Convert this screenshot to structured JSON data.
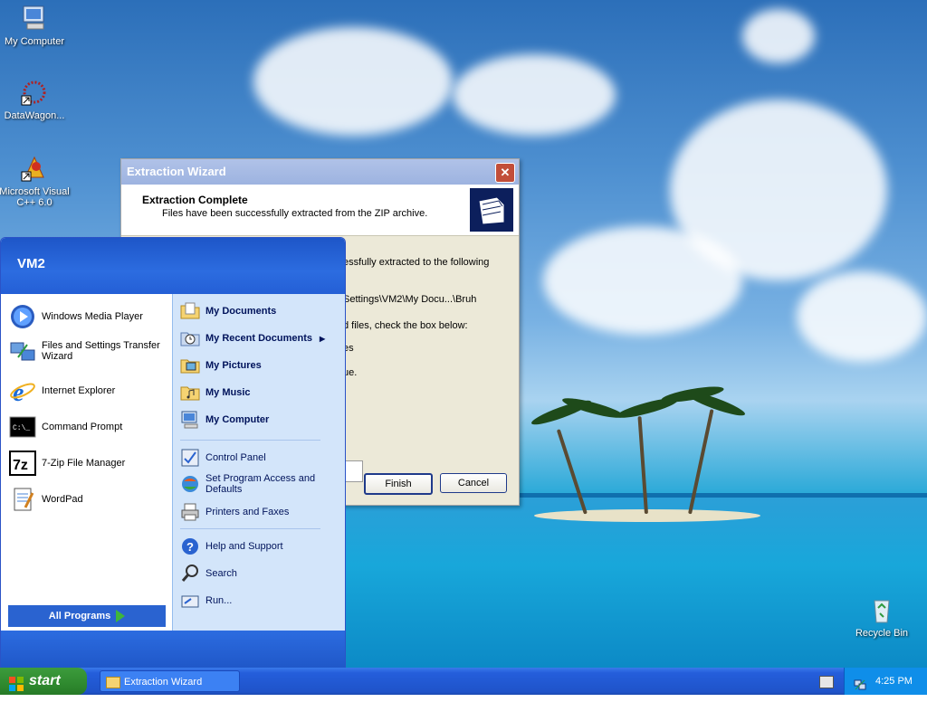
{
  "desktop": {
    "icons": [
      {
        "label": "My Computer"
      },
      {
        "label": "DataWagon..."
      },
      {
        "label": "Microsoft Visual C++ 6.0"
      },
      {
        "label": "Recycle Bin"
      }
    ]
  },
  "wizard": {
    "title": "Extraction Wizard",
    "close_label": "✕",
    "header_title": "Extraction Complete",
    "header_subtitle": "Files have been successfully extracted from the ZIP archive.",
    "body_lines": [
      "essfully extracted to the following",
      "Settings\\VM2\\My Docu...\\Bruh",
      "d files, check the box below:",
      "es",
      "ue."
    ],
    "finish_label": "Finish",
    "cancel_label": "Cancel"
  },
  "startmenu": {
    "user": "VM2",
    "pinned": [
      {
        "label": "Windows Media Player"
      },
      {
        "label": "Files and Settings Transfer Wizard"
      },
      {
        "label": "Internet Explorer"
      },
      {
        "label": "Command Prompt"
      },
      {
        "label": "7-Zip File Manager"
      },
      {
        "label": "WordPad"
      }
    ],
    "all_programs": "All Programs",
    "right_items": [
      {
        "label": "My Documents"
      },
      {
        "label": "My Recent Documents"
      },
      {
        "label": "My Pictures"
      },
      {
        "label": "My Music"
      },
      {
        "label": "My Computer"
      },
      {
        "label": "Control Panel"
      },
      {
        "label": "Set Program Access and Defaults"
      },
      {
        "label": "Printers and Faxes"
      },
      {
        "label": "Help and Support"
      },
      {
        "label": "Search"
      },
      {
        "label": "Run..."
      }
    ]
  },
  "taskbar": {
    "start_label": "start",
    "task_button": "Extraction Wizard",
    "clock": "4:25 PM"
  },
  "colors": {
    "taskbar_blue": "#245edb",
    "start_green": "#2f8a2f",
    "menu_right_bg": "#d3e5fa"
  }
}
